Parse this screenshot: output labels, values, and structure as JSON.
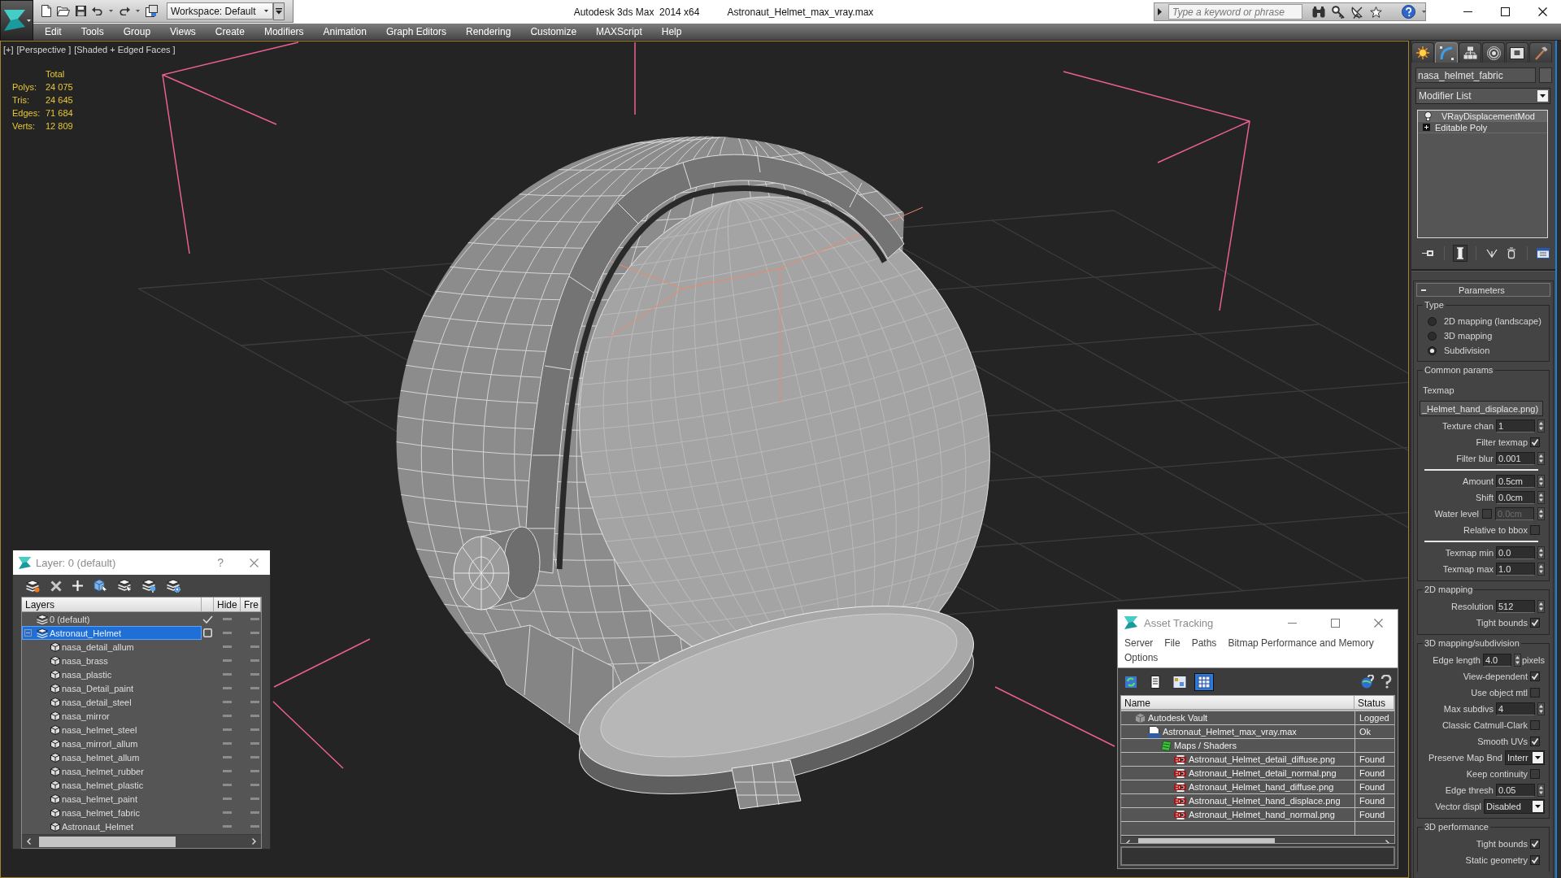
{
  "window": {
    "app_title": "Autodesk 3ds Max  2014 x64",
    "file_title": "Astronaut_Helmet_max_vray.max"
  },
  "quick_access": {
    "workspace": "Workspace: Default"
  },
  "search": {
    "placeholder": "Type a keyword or phrase"
  },
  "menu": [
    "Edit",
    "Tools",
    "Group",
    "Views",
    "Create",
    "Modifiers",
    "Animation",
    "Graph Editors",
    "Rendering",
    "Customize",
    "MAXScript",
    "Help"
  ],
  "viewport": {
    "labels": [
      "[+]",
      "[Perspective ]",
      "[Shaded + Edged Faces ]"
    ],
    "stats": {
      "header": "Total",
      "rows": [
        {
          "label": "Polys:",
          "value": "24 075"
        },
        {
          "label": "Tris:",
          "value": "24 645"
        },
        {
          "label": "Edges:",
          "value": "71 684"
        },
        {
          "label": "Verts:",
          "value": "12 809"
        }
      ]
    }
  },
  "layer_window": {
    "title": "Layer: 0 (default)",
    "help": "?",
    "columns": [
      "Layers",
      "Hide",
      "Fre"
    ],
    "layers": [
      {
        "kind": "layer",
        "name": "0 (default)",
        "selected": false,
        "current": true,
        "hidden": false,
        "frozen": false
      },
      {
        "kind": "layer",
        "name": "Astronaut_Helmet",
        "selected": true,
        "current": false,
        "expanded": true,
        "hidden": false,
        "frozen": false,
        "children": [
          {
            "kind": "object",
            "name": "nasa_detail_allum",
            "selected": false,
            "hidden": false,
            "frozen": false
          },
          {
            "kind": "object",
            "name": "nasa_brass",
            "selected": false,
            "hidden": false,
            "frozen": false
          },
          {
            "kind": "object",
            "name": "nasa_plastic",
            "selected": false,
            "hidden": false,
            "frozen": false
          },
          {
            "kind": "object",
            "name": "nasa_Detail_paint",
            "selected": false,
            "hidden": false,
            "frozen": false
          },
          {
            "kind": "object",
            "name": "nasa_detail_steel",
            "selected": false,
            "hidden": false,
            "frozen": false
          },
          {
            "kind": "object",
            "name": "nasa_mirror",
            "selected": false,
            "hidden": false,
            "frozen": false
          },
          {
            "kind": "object",
            "name": "nasa_helmet_steel",
            "selected": false,
            "hidden": false,
            "frozen": false
          },
          {
            "kind": "object",
            "name": "nasa_mirrorl_allum",
            "selected": false,
            "hidden": false,
            "frozen": false
          },
          {
            "kind": "object",
            "name": "nasa_helmet_allum",
            "selected": false,
            "hidden": false,
            "frozen": false
          },
          {
            "kind": "object",
            "name": "nasa_helmet_rubber",
            "selected": false,
            "hidden": false,
            "frozen": false
          },
          {
            "kind": "object",
            "name": "nasa_helmet_plastic",
            "selected": false,
            "hidden": false,
            "frozen": false
          },
          {
            "kind": "object",
            "name": "nasa_helmet_paint",
            "selected": false,
            "hidden": false,
            "frozen": false
          },
          {
            "kind": "object",
            "name": "nasa_helmet_fabric",
            "selected": false,
            "hidden": false,
            "frozen": false
          },
          {
            "kind": "object",
            "name": "Astronaut_Helmet",
            "selected": false,
            "hidden": false,
            "frozen": false
          }
        ]
      }
    ]
  },
  "asset_tracking": {
    "title": "Asset Tracking",
    "menu": [
      "Server",
      "File",
      "Paths",
      "Bitmap Performance and Memory",
      "Options"
    ],
    "toolbar": [
      {
        "kind": "refresh",
        "selected": false
      },
      {
        "kind": "list",
        "selected": false
      },
      {
        "kind": "thumbnails",
        "selected": false
      },
      {
        "kind": "table",
        "selected": true
      }
    ],
    "columns": [
      "Name",
      "Status"
    ],
    "tree": [
      {
        "kind": "vault",
        "name": "Autodesk Vault",
        "status": "Logged",
        "children": [
          {
            "kind": "max",
            "name": "Astronaut_Helmet_max_vray.max",
            "status": "Ok",
            "children": [
              {
                "kind": "maps",
                "name": "Maps / Shaders",
                "children": [
                  {
                    "kind": "png",
                    "name": "Astronaut_Helmet_detail_diffuse.png",
                    "status": "Found"
                  },
                  {
                    "kind": "png",
                    "name": "Astronaut_Helmet_detail_normal.png",
                    "status": "Found"
                  },
                  {
                    "kind": "png",
                    "name": "Astronaut_Helmet_hand_diffuse.png",
                    "status": "Found"
                  },
                  {
                    "kind": "png",
                    "name": "Astronaut_Helmet_hand_displace.png",
                    "status": "Found"
                  },
                  {
                    "kind": "png",
                    "name": "Astronaut_Helmet_hand_normal.png",
                    "status": "Found"
                  }
                ]
              }
            ]
          }
        ]
      }
    ]
  },
  "command_panel": {
    "tabs": [
      {
        "kind": "create",
        "selected": false
      },
      {
        "kind": "modify",
        "selected": true
      },
      {
        "kind": "hierarchy",
        "selected": false
      },
      {
        "kind": "motion",
        "selected": false
      },
      {
        "kind": "display",
        "selected": false
      },
      {
        "kind": "utilities",
        "selected": false
      }
    ],
    "object_name": "nasa_helmet_fabric",
    "modifier_list": "Modifier List",
    "stack": [
      {
        "kind": "modifier",
        "name": "VRayDisplacementMod",
        "selected": true
      },
      {
        "kind": "base",
        "name": "Editable Poly",
        "selected": false,
        "expanded": false
      }
    ],
    "stack_tools": [
      {
        "kind": "pin",
        "on": false
      },
      {
        "kind": "end_result",
        "on": true
      },
      {
        "kind": "unique",
        "on": false
      },
      {
        "kind": "remove",
        "on": false
      },
      {
        "kind": "configure",
        "on": false
      }
    ],
    "rollout": {
      "title": "Parameters",
      "groups": [
        {
          "title": "Type",
          "rows": [
            {
              "kind": "radio",
              "label": "2D mapping (landscape)",
              "selected": false
            },
            {
              "kind": "radio",
              "label": "3D mapping",
              "selected": false
            },
            {
              "kind": "radio",
              "label": "Subdivision",
              "selected": true
            }
          ]
        },
        {
          "title": "Common params",
          "rows": [
            {
              "kind": "label",
              "label": "Texmap"
            },
            {
              "kind": "button",
              "label": "_Helmet_hand_displace.png)"
            },
            {
              "kind": "spinner",
              "label": "Texture chan",
              "value": "1"
            },
            {
              "kind": "checkbox",
              "label": "Filter texmap",
              "checked": true
            },
            {
              "kind": "spinner",
              "label": "Filter blur",
              "value": "0.001"
            },
            {
              "kind": "separator"
            },
            {
              "kind": "spinner",
              "label": "Amount",
              "value": "0.5cm"
            },
            {
              "kind": "spinner",
              "label": "Shift",
              "value": "0.0cm"
            },
            {
              "kind": "check_spinner",
              "label": "Water level",
              "checked": false,
              "value": "0.0cm"
            },
            {
              "kind": "checkbox",
              "label": "Relative to bbox",
              "checked": false
            },
            {
              "kind": "separator"
            },
            {
              "kind": "spinner",
              "label": "Texmap min",
              "value": "0.0"
            },
            {
              "kind": "spinner",
              "label": "Texmap max",
              "value": "1.0"
            }
          ]
        },
        {
          "title": "2D mapping",
          "rows": [
            {
              "kind": "spinner",
              "label": "Resolution",
              "value": "512"
            },
            {
              "kind": "checkbox",
              "label": "Tight bounds",
              "checked": true
            }
          ]
        },
        {
          "title": "3D mapping/subdivision",
          "rows": [
            {
              "kind": "spinner",
              "label": "Edge length",
              "value": "4.0",
              "unit": "pixels"
            },
            {
              "kind": "checkbox",
              "label": "View-dependent",
              "checked": true
            },
            {
              "kind": "checkbox",
              "label": "Use object mtl",
              "checked": false
            },
            {
              "kind": "spinner",
              "label": "Max subdivs",
              "value": "4"
            },
            {
              "kind": "checkbox",
              "label": "Classic Catmull-Clark",
              "checked": false
            },
            {
              "kind": "checkbox",
              "label": "Smooth UVs",
              "checked": true
            },
            {
              "kind": "dropdown",
              "label": "Preserve Map Bnd",
              "value": "Interr"
            },
            {
              "kind": "checkbox",
              "label": "Keep continuity",
              "checked": false
            },
            {
              "kind": "spinner",
              "label": "Edge thresh",
              "value": "0.05"
            },
            {
              "kind": "dropdown",
              "label": "Vector displ",
              "value": "Disabled"
            }
          ]
        },
        {
          "title": "3D performance",
          "rows": [
            {
              "kind": "checkbox",
              "label": "Tight bounds",
              "checked": true
            },
            {
              "kind": "checkbox",
              "label": "Static geometry",
              "checked": true
            }
          ]
        }
      ]
    }
  }
}
